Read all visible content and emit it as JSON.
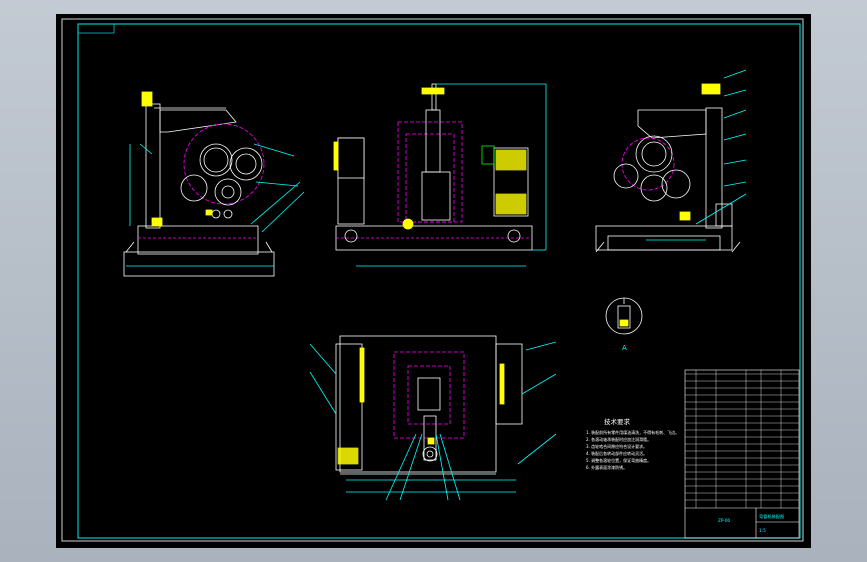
{
  "drawing": {
    "background": "#000000",
    "frame_color": "#00c8c8",
    "line_color": "#ffffff",
    "hidden_color": "#ff00ff",
    "dim_color": "#00ffff",
    "highlight_color": "#ffff00",
    "accent_color": "#00ff00"
  },
  "tech_notes": {
    "title": "技术要求",
    "lines": [
      "1. 装配前所有零件用煤油清洗，不得有毛刺、飞边。",
      "2. 各滚动轴承装配时应加注润滑脂。",
      "3. 齿轮啮合间隙应符合设计要求。",
      "4. 装配后各转动部件应转动灵活。",
      "5. 调整各滚轮位置，保证弯曲精度。",
      "6. 外露表面涂漆防锈。"
    ]
  },
  "title_block": {
    "drawing_name": "弯管机装配图",
    "scale": "1:5",
    "code": "ZP-00"
  },
  "detail_label": "A"
}
